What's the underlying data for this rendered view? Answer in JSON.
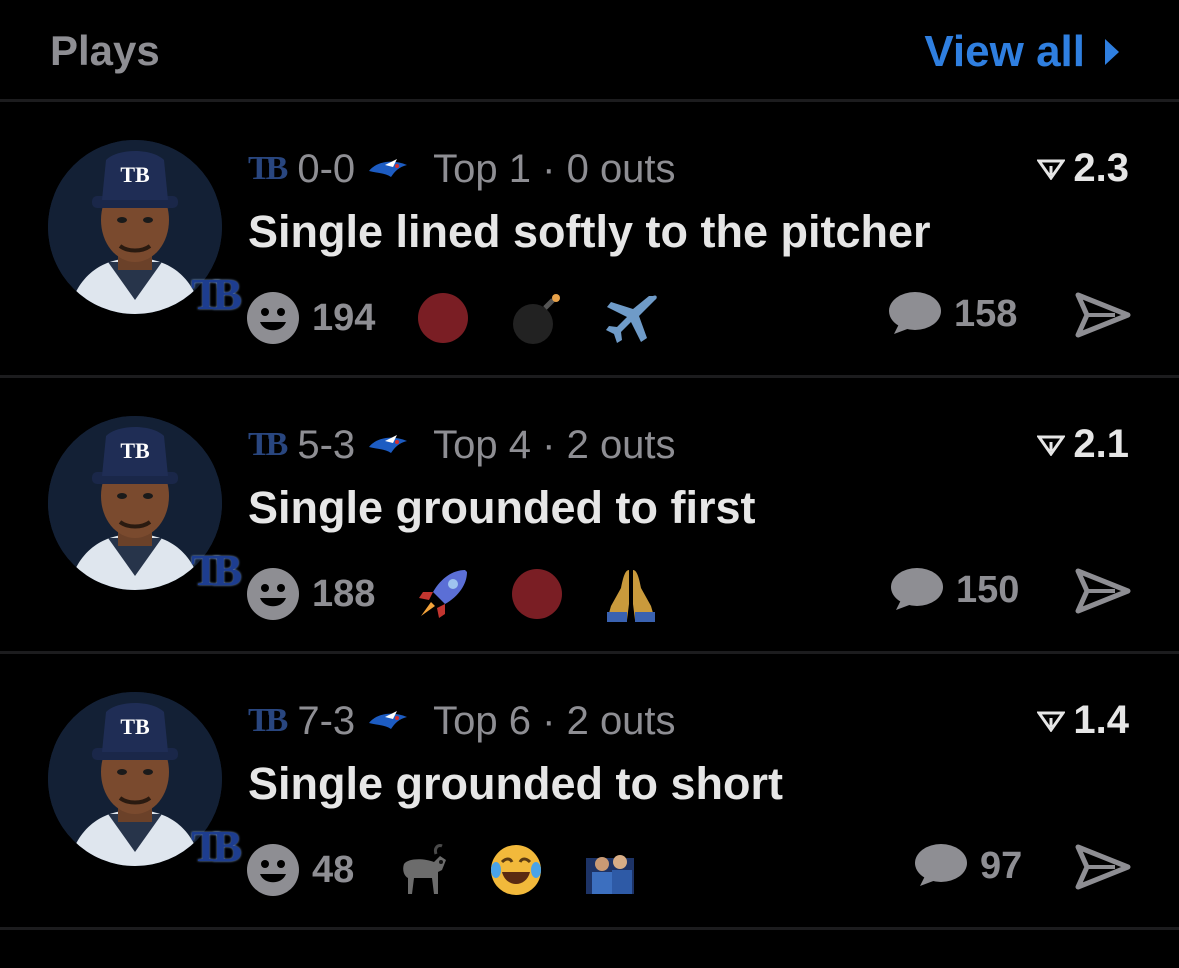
{
  "header": {
    "title": "Plays",
    "view_all": "View all"
  },
  "colors": {
    "background": "#000000",
    "accent": "#2f7fe0",
    "muted_text": "#8e8e93",
    "primary_text": "#e6e6e6",
    "divider": "#1c1c1e"
  },
  "plays": [
    {
      "score": "0-0",
      "inning": "Top 1",
      "outs": "0 outs",
      "rating": "2.3",
      "description": "Single lined softly to the pitcher",
      "reaction_count": "194",
      "emojis": [
        "red-circle-icon",
        "bomb-icon",
        "airplane-icon"
      ],
      "comment_count": "158"
    },
    {
      "score": "5-3",
      "inning": "Top 4",
      "outs": "2 outs",
      "rating": "2.1",
      "description": "Single grounded to first",
      "reaction_count": "188",
      "emojis": [
        "rocket-icon",
        "red-circle-icon",
        "praying-hands-icon"
      ],
      "comment_count": "150"
    },
    {
      "score": "7-3",
      "inning": "Top 6",
      "outs": "2 outs",
      "rating": "1.4",
      "description": "Single grounded to short",
      "reaction_count": "48",
      "emojis": [
        "goat-icon",
        "tears-of-joy-icon",
        "custom-photo-emoji-icon"
      ],
      "comment_count": "97"
    }
  ]
}
